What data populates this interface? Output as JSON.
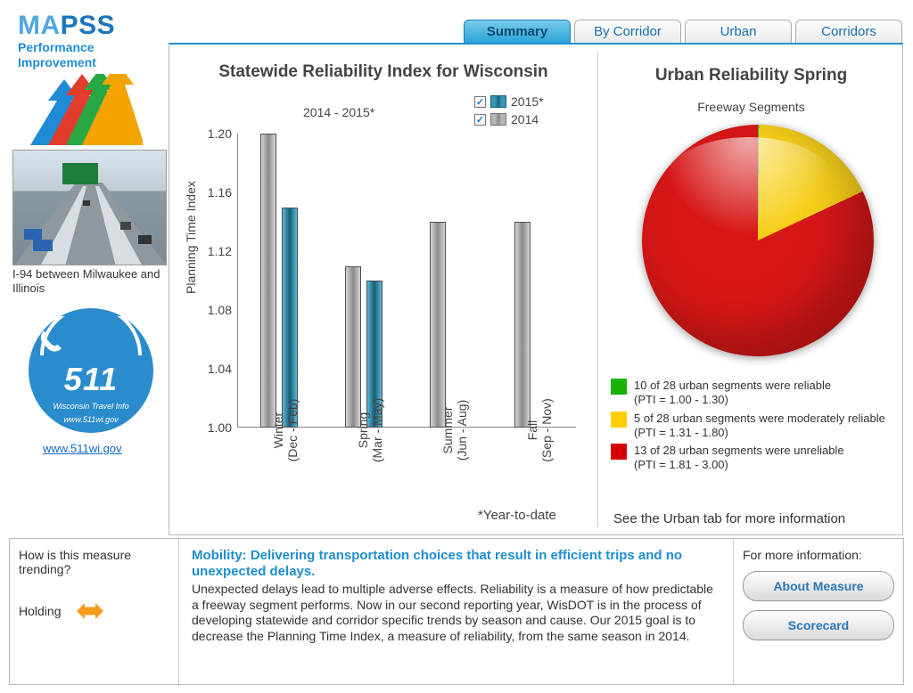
{
  "logo": {
    "word": "MAPSS",
    "sub1": "Performance",
    "sub2": "Improvement"
  },
  "tabs": {
    "t0": "Summary",
    "t1": "By Corridor",
    "t2": "Urban",
    "t3": "Corridors"
  },
  "side": {
    "caption": "I-94 between Milwaukee and Illinois",
    "badge_num": "511",
    "badge_line1": "Wisconsin Travel Info",
    "badge_line2": "www.511wi.gov",
    "link": "www.511wi.gov"
  },
  "chart_data": [
    {
      "type": "bar",
      "title": "Statewide Reliability Index for Wisconsin",
      "subtitle": "2014 - 2015*",
      "ylabel": "Planning Time Index",
      "xlabel": "",
      "ylim": [
        1.0,
        1.2
      ],
      "yticks": [
        1.0,
        1.04,
        1.08,
        1.12,
        1.16,
        1.2
      ],
      "categories": [
        "Winter\n(Dec - Feb)",
        "Spring\n(Mar - May)",
        "Summer\n(Jun - Aug)",
        "Fall\n(Sep - Nov)"
      ],
      "series": [
        {
          "name": "2014",
          "values": [
            1.2,
            1.11,
            1.14,
            1.14
          ]
        },
        {
          "name": "2015*",
          "values": [
            1.15,
            1.1,
            null,
            null
          ]
        }
      ],
      "footnote": "*Year-to-date"
    },
    {
      "type": "pie",
      "title": "Urban Reliability Spring",
      "subtitle": "Freeway Segments",
      "slices": [
        {
          "label": "reliable",
          "value": 10,
          "total": 28,
          "range": "PTI = 1.00 - 1.30",
          "color": "#32b74f"
        },
        {
          "label": "moderately reliable",
          "value": 5,
          "total": 28,
          "range": "PTI = 1.31 - 1.80",
          "color": "#f7cf1a"
        },
        {
          "label": "unreliable",
          "value": 13,
          "total": 28,
          "range": "PTI = 1.81 - 3.00",
          "color": "#d71717"
        }
      ],
      "see_more": "See the Urban tab for more information"
    }
  ],
  "legend": {
    "l2015": "2015*",
    "l2014": "2014"
  },
  "pie_legend": {
    "g": "10 of 28 urban segments were reliable\n(PTI = 1.00 - 1.30)",
    "y": "5 of 28 urban segments were moderately reliable\n(PTI = 1.31 - 1.80)",
    "r": "13 of 28 urban segments were unreliable\n(PTI = 1.81 - 3.00)"
  },
  "bottom": {
    "trend_q": "How is this measure trending?",
    "trend_v": "Holding",
    "mob_h": "Mobility: Delivering transportation choices that result in efficient trips and no unexpected delays.",
    "mob_b": "Unexpected delays lead to multiple adverse effects. Reliability is a measure of how predictable a freeway segment performs. Now in our second reporting year, WisDOT is in the process of developing statewide and corridor specific trends by season and cause. Our 2015 goal is to decrease the Planning Time Index, a measure of reliability, from the same season in 2014.",
    "more_h": "For more information:",
    "btn1": "About Measure",
    "btn2": "Scorecard"
  }
}
